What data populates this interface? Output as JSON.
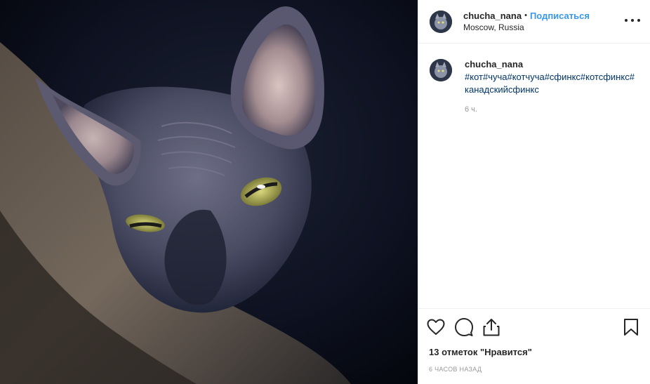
{
  "post": {
    "username": "chucha_nana",
    "separator": "•",
    "follow_label": "Подписаться",
    "location": "Moscow, Russia",
    "more_icon": "more-horizontal-icon",
    "image_alt": "sphynx-cat-photo"
  },
  "caption": {
    "username": "chucha_nana",
    "text": "#кот#чуча#котчуча#сфинкс#котсфинкс#канадскийсфинкс",
    "time": "6 ч."
  },
  "actions": {
    "icons": [
      "heart-icon",
      "comment-icon",
      "share-icon",
      "bookmark-icon"
    ],
    "likes": "13 отметок \"Нравится\"",
    "time_ago": "6 часов назад"
  },
  "colors": {
    "link_blue": "#3897f0",
    "hashtag": "#003569",
    "muted": "#999999",
    "border": "#efefef"
  }
}
